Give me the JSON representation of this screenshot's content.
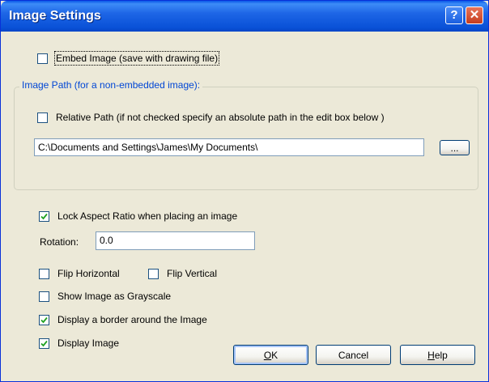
{
  "window": {
    "title": "Image Settings",
    "help_button": "?",
    "close_button": "✕"
  },
  "embed_image": {
    "label": "Embed Image (save with drawing file)",
    "checked": false
  },
  "image_path_group": {
    "title": "Image Path (for a non-embedded image):",
    "relative_path": {
      "label": "Relative Path (if not checked specify an absolute path in the edit box below )",
      "checked": false
    },
    "path_value": "C:\\Documents and Settings\\James\\My Documents\\",
    "browse_label": "..."
  },
  "lock_aspect_ratio": {
    "label": "Lock Aspect Ratio when placing an image",
    "checked": true
  },
  "rotation": {
    "label": "Rotation:",
    "value": "0.0"
  },
  "flip_horizontal": {
    "label": "Flip Horizontal",
    "checked": false
  },
  "flip_vertical": {
    "label": "Flip Vertical",
    "checked": false
  },
  "grayscale": {
    "label": "Show Image as Grayscale",
    "checked": false
  },
  "display_border": {
    "label": "Display a border around the Image",
    "checked": true
  },
  "display_image": {
    "label": "Display Image",
    "checked": true
  },
  "buttons": {
    "ok": {
      "prefix": "",
      "mnemonic": "O",
      "rest": "K"
    },
    "cancel": "Cancel",
    "help": {
      "prefix": "",
      "mnemonic": "H",
      "rest": "elp"
    }
  },
  "colors": {
    "titlebar": "#0a52d8",
    "dialog_bg": "#ece9d8",
    "group_title": "#0046d5",
    "checkmark": "#21a121"
  }
}
